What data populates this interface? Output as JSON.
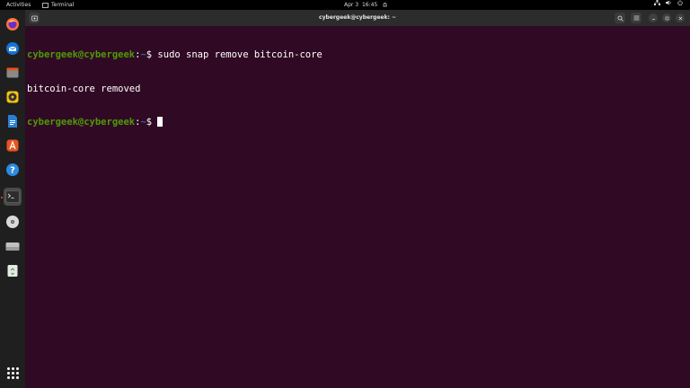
{
  "topbar": {
    "activities": "Activities",
    "app_name": "Terminal",
    "clock_date": "Apr 3",
    "clock_time": "16:45"
  },
  "dock": {
    "items": [
      {
        "name": "firefox",
        "active": false
      },
      {
        "name": "thunderbird",
        "active": false
      },
      {
        "name": "files",
        "active": false
      },
      {
        "name": "rhythmbox",
        "active": false
      },
      {
        "name": "libreoffice-writer",
        "active": false
      },
      {
        "name": "app-center",
        "active": false
      },
      {
        "name": "help",
        "active": false
      },
      {
        "name": "terminal",
        "active": true
      },
      {
        "name": "optical-disc",
        "active": false
      },
      {
        "name": "drive",
        "active": false
      },
      {
        "name": "trash",
        "active": false
      }
    ]
  },
  "window": {
    "title": "cybergeek@cybergeek: ~"
  },
  "terminal": {
    "lines": [
      {
        "user": "cybergeek@cybergeek",
        "sep": ":",
        "path": "~",
        "prompt": "$ ",
        "cmd": "sudo snap remove bitcoin-core"
      },
      {
        "output": "bitcoin-core removed"
      },
      {
        "user": "cybergeek@cybergeek",
        "sep": ":",
        "path": "~",
        "prompt": "$ ",
        "cmd": ""
      }
    ]
  },
  "colors": {
    "terminal_bg": "#300a24",
    "prompt_user": "#4e9a06",
    "prompt_path": "#3465a4",
    "accent": "#e95420"
  }
}
